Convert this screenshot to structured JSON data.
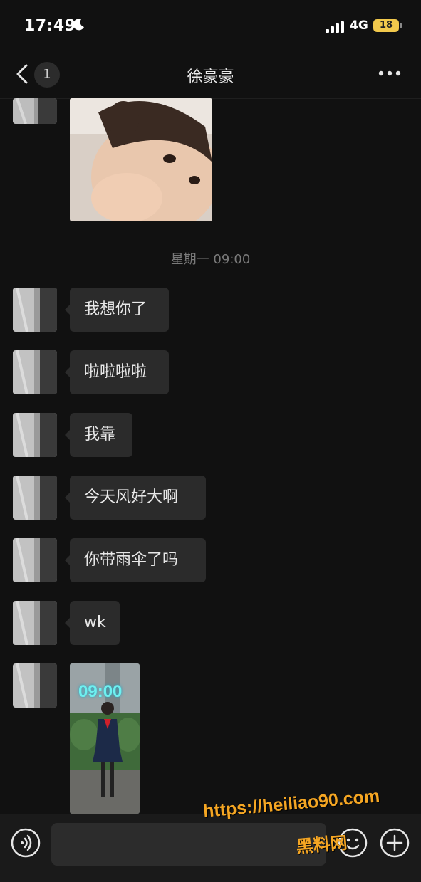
{
  "status_bar": {
    "time": "17:49",
    "network": "4G",
    "battery": "18",
    "icons": [
      "moon-icon",
      "signal-icon"
    ]
  },
  "nav": {
    "back_badge": "1",
    "title": "徐豪豪",
    "icons": [
      "back-icon",
      "more-icon"
    ]
  },
  "timestamp": "星期一 09:00",
  "messages": [
    {
      "type": "image",
      "content": "photo of a little girl"
    },
    {
      "type": "text",
      "text": "我想你了"
    },
    {
      "type": "text",
      "text": "啦啦啦啦"
    },
    {
      "type": "text",
      "text": "我靠"
    },
    {
      "type": "text",
      "text": "今天风好大啊"
    },
    {
      "type": "text",
      "text": "你带雨伞了吗"
    },
    {
      "type": "text",
      "text": "wk"
    },
    {
      "type": "image",
      "lockscreen_time": "09:00"
    }
  ],
  "input_bar": {
    "placeholder": "",
    "icons": [
      "voice-icon",
      "emoji-icon",
      "plus-icon"
    ]
  },
  "watermark": {
    "url": "https://heiliao90.com",
    "name": "黑料网"
  },
  "colors": {
    "background": "#111111",
    "bubble": "#2b2b2b",
    "watermark": "#f5a623",
    "battery": "#f2c94c"
  }
}
